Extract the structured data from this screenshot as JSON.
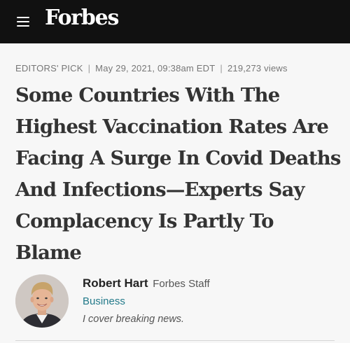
{
  "header": {
    "logo_text": "Forbes",
    "menu_icon": "hamburger-menu-icon",
    "background_color": "#111111"
  },
  "article": {
    "meta": {
      "label": "EDITORS' PICK",
      "date": "May 29, 2021, 09:38am EDT",
      "views": "219,273 views"
    },
    "headline_lines": [
      "Some Countries With The",
      "Highest Vaccination Rates Are",
      "Facing A Surge In Covid Deaths",
      "And Infections—Experts Say",
      "Complacency Is Partly To",
      "Blame"
    ]
  },
  "author": {
    "name": "Robert Hart",
    "role": "Forbes Staff",
    "section": "Business",
    "bio": "I cover breaking news.",
    "accent_color": "#237a8a"
  }
}
